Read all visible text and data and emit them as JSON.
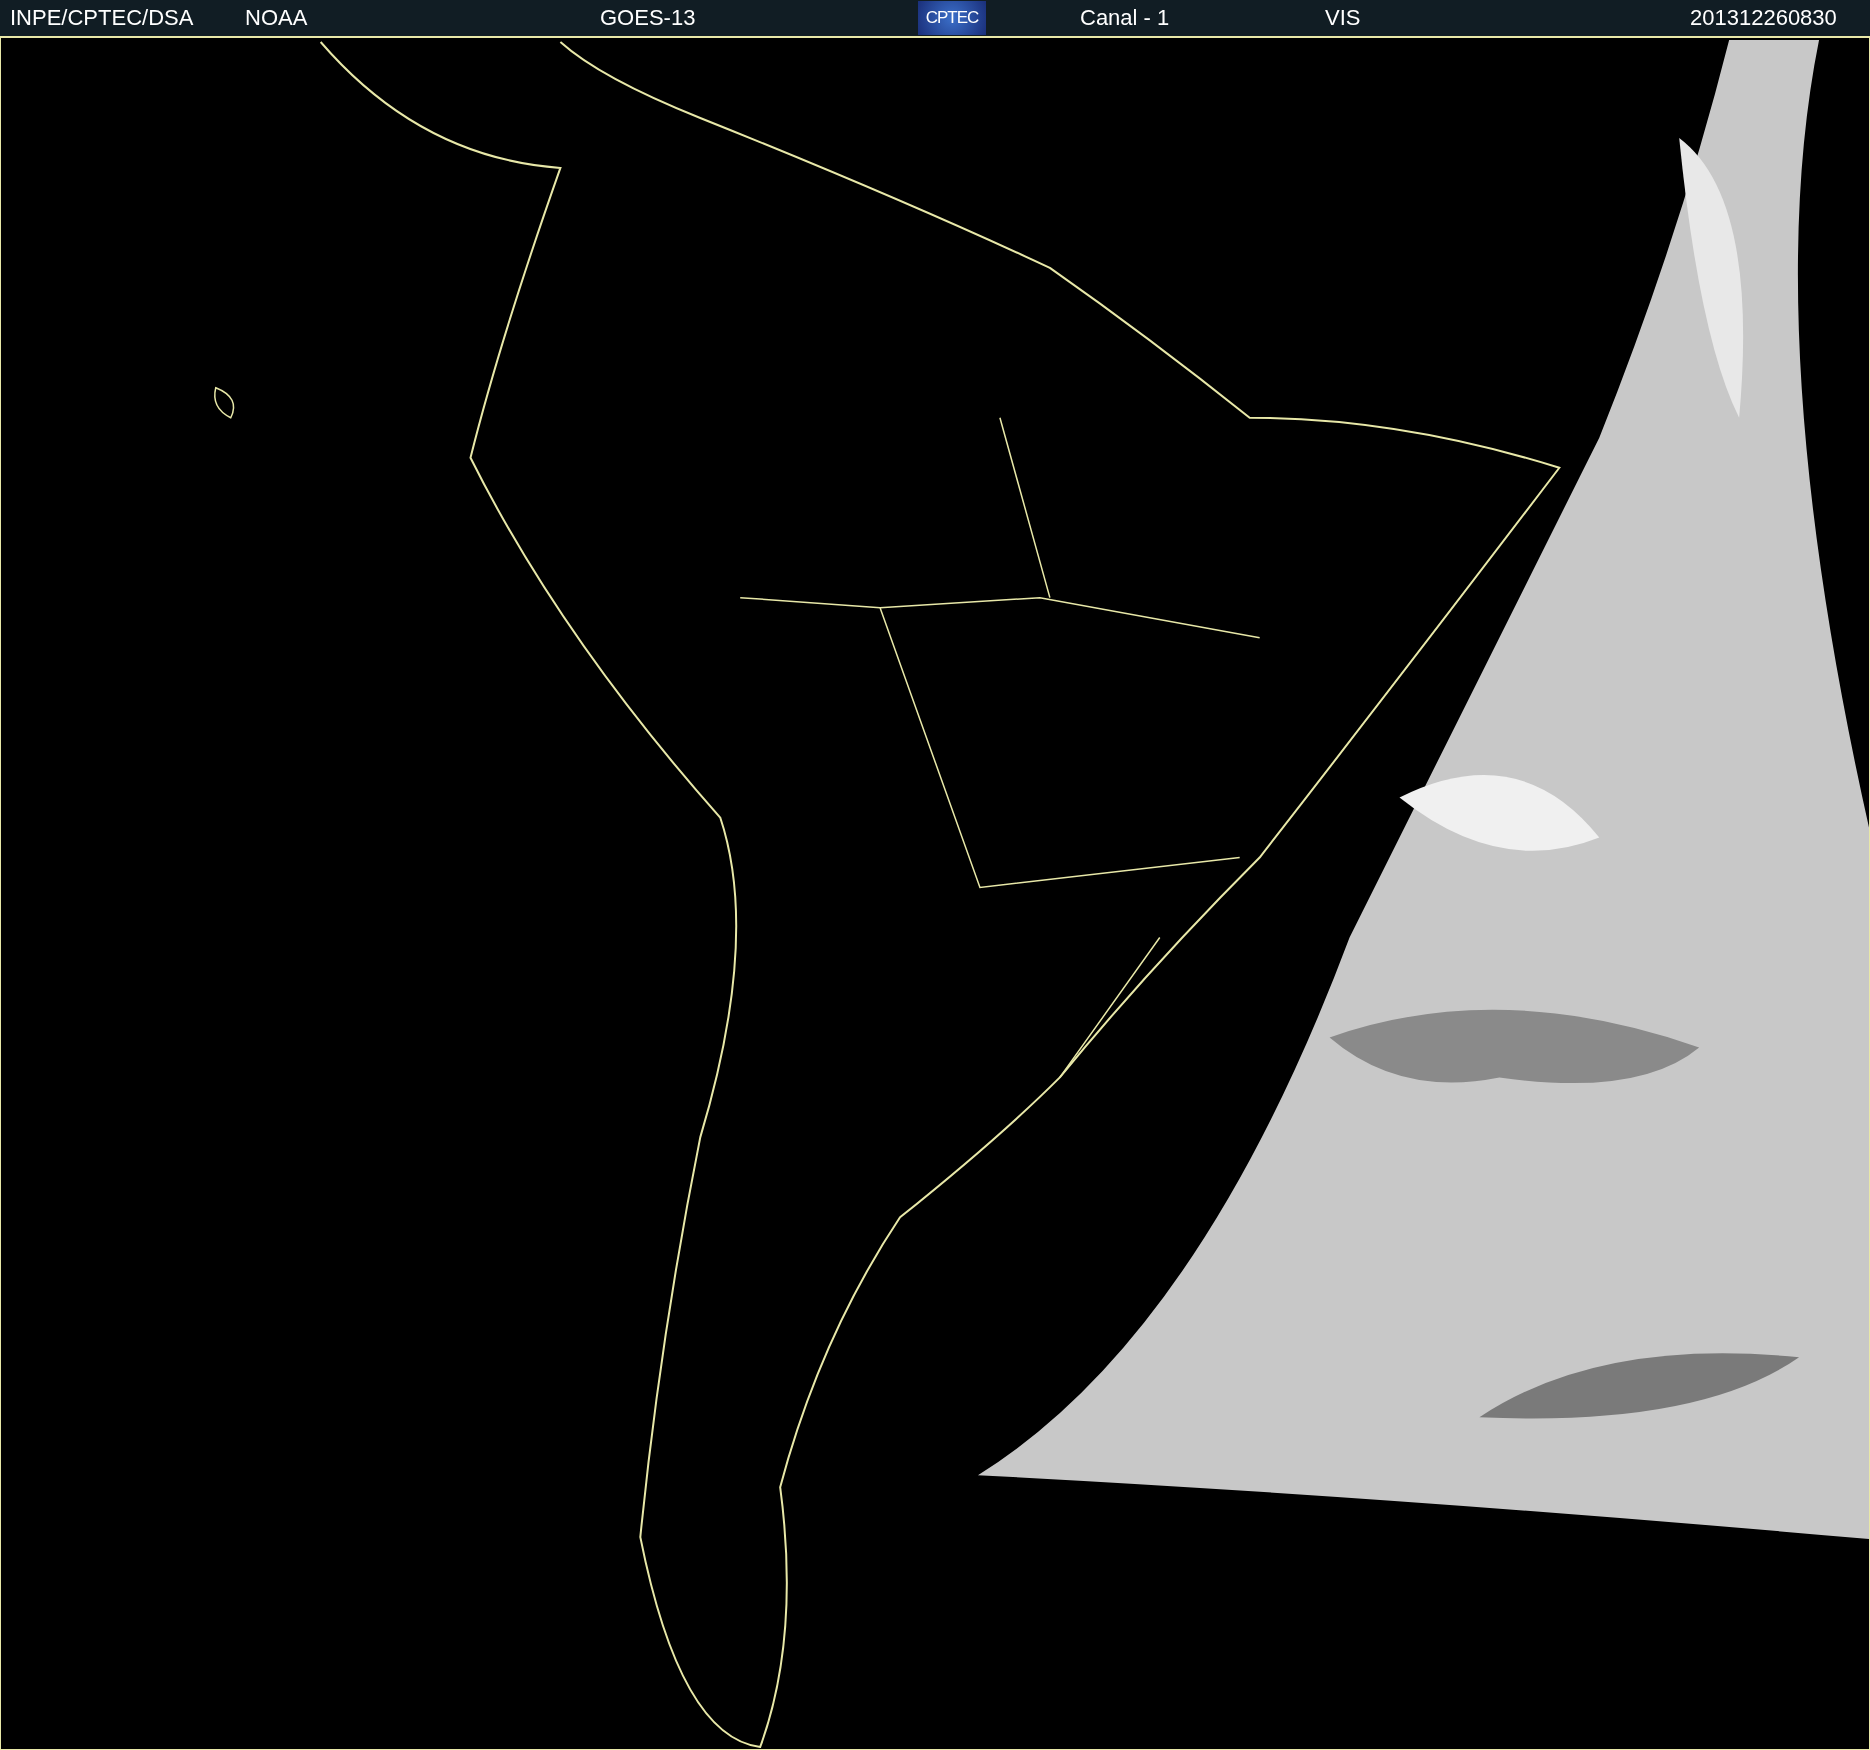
{
  "header": {
    "source": "INPE/CPTEC/DSA",
    "agency": "NOAA",
    "satellite": "GOES-13",
    "logo_text": "CPTEC",
    "channel": "Canal - 1",
    "band": "VIS",
    "timestamp": "201312260830"
  }
}
